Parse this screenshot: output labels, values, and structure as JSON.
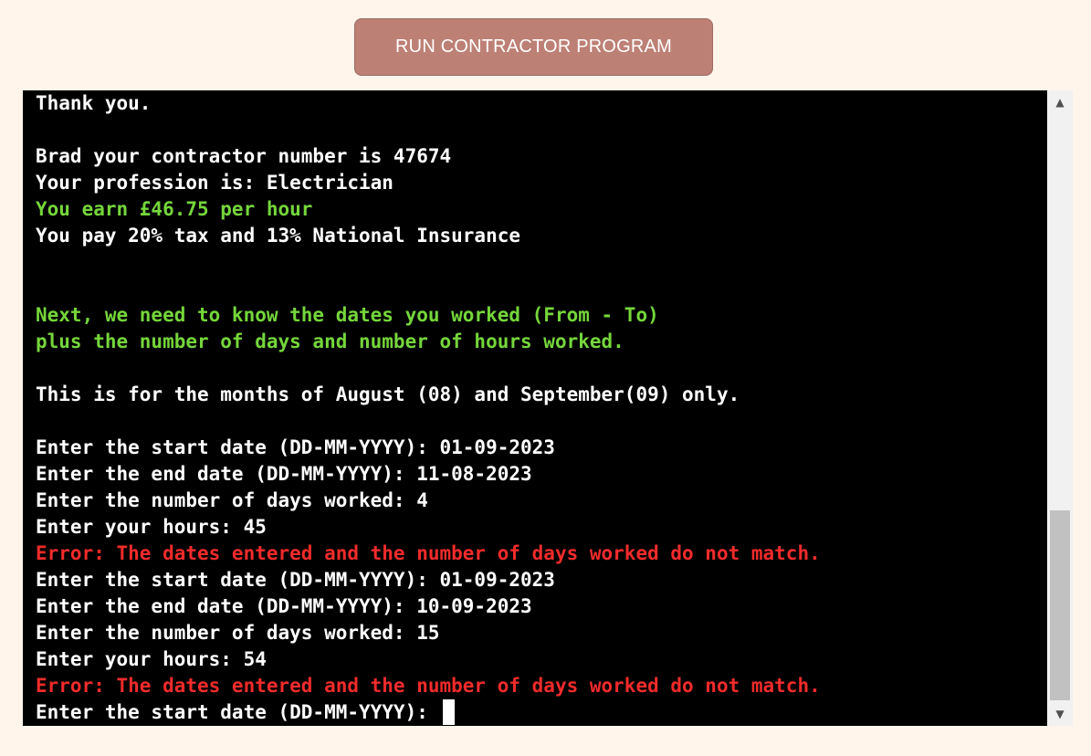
{
  "run_button": {
    "label": "RUN CONTRACTOR PROGRAM"
  },
  "colors": {
    "page_background": "#fff5eb",
    "button_background": "#bd8075",
    "terminal_background": "#000000",
    "text_white": "#ffffff",
    "text_green": "#75d63b",
    "text_red": "#f22b2b"
  },
  "terminal": {
    "lines": [
      {
        "text": "Thank you.",
        "color": "white"
      },
      {
        "text": "",
        "color": "white"
      },
      {
        "text": "Brad your contractor number is 47674",
        "color": "white"
      },
      {
        "text": "Your profession is: Electrician",
        "color": "white"
      },
      {
        "text": "You earn £46.75 per hour",
        "color": "green"
      },
      {
        "text": "You pay 20% tax and 13% National Insurance",
        "color": "white"
      },
      {
        "text": "",
        "color": "white"
      },
      {
        "text": "",
        "color": "white"
      },
      {
        "text": "Next, we need to know the dates you worked (From - To)",
        "color": "green"
      },
      {
        "text": "plus the number of days and number of hours worked.",
        "color": "green"
      },
      {
        "text": "",
        "color": "white"
      },
      {
        "text": "This is for the months of August (08) and September(09) only.",
        "color": "white"
      },
      {
        "text": "",
        "color": "white"
      },
      {
        "text": "Enter the start date (DD-MM-YYYY): 01-09-2023",
        "color": "white"
      },
      {
        "text": "Enter the end date (DD-MM-YYYY): 11-08-2023",
        "color": "white"
      },
      {
        "text": "Enter the number of days worked: 4",
        "color": "white"
      },
      {
        "text": "Enter your hours: 45",
        "color": "white"
      },
      {
        "text": "Error: The dates entered and the number of days worked do not match.",
        "color": "red"
      },
      {
        "text": "Enter the start date (DD-MM-YYYY): 01-09-2023",
        "color": "white"
      },
      {
        "text": "Enter the end date (DD-MM-YYYY): 10-09-2023",
        "color": "white"
      },
      {
        "text": "Enter the number of days worked: 15",
        "color": "white"
      },
      {
        "text": "Enter your hours: 54",
        "color": "white"
      },
      {
        "text": "Error: The dates entered and the number of days worked do not match.",
        "color": "red"
      }
    ],
    "prompt_line": "Enter the start date (DD-MM-YYYY): "
  },
  "scrollbar": {
    "up_icon": "scroll-up-arrow-icon",
    "down_icon": "scroll-down-arrow-icon",
    "up_glyph": "▲",
    "down_glyph": "▼"
  }
}
